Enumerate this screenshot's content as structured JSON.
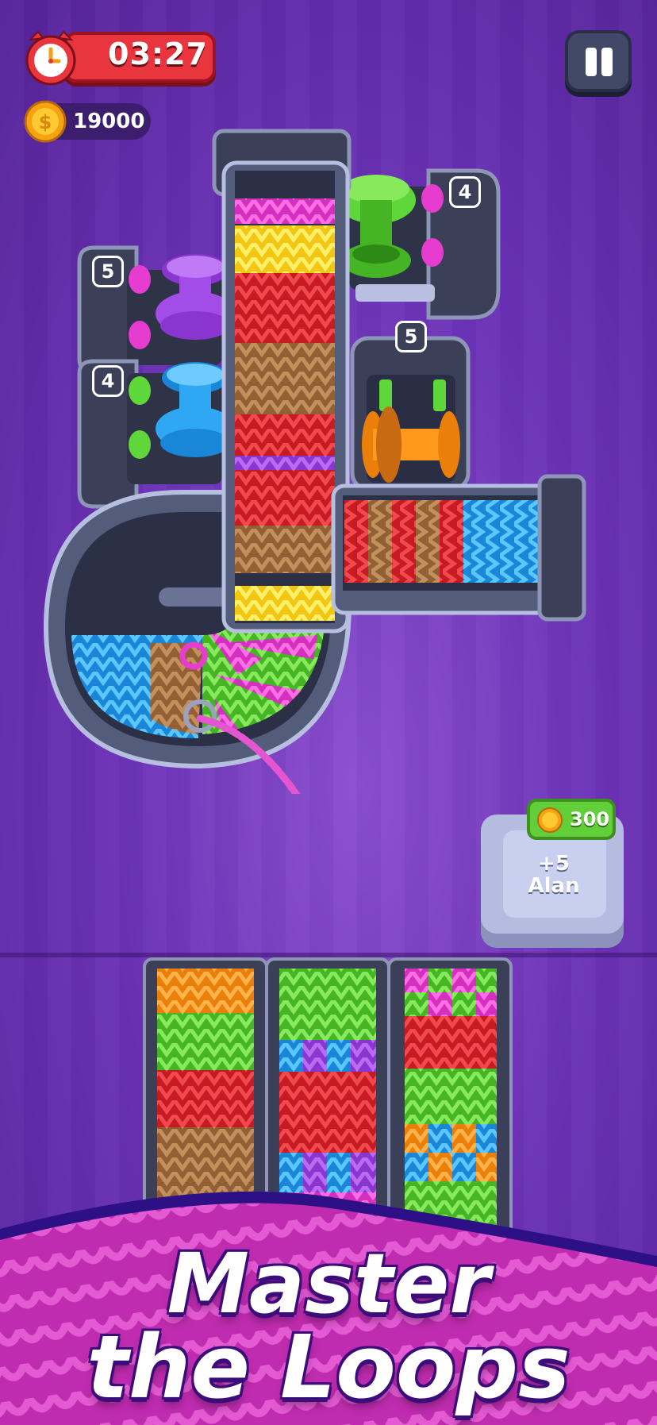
{
  "hud": {
    "timer": "03:27",
    "coins": "19000",
    "timer_icon": "alarm-clock-icon",
    "coin_icon": "coin-icon",
    "pause_icon": "pause-icon"
  },
  "spool_slots": [
    {
      "count": "5"
    },
    {
      "count": "4"
    },
    {
      "count": "4"
    },
    {
      "count": "5"
    }
  ],
  "promo": {
    "price": "300",
    "reward_line1": "+5",
    "reward_line2": "Alan"
  },
  "tagline": {
    "line1": "Master",
    "line2": "the Loops"
  },
  "colors": {
    "pink": "#e63ccf",
    "yellow": "#ffe132",
    "red": "#e8262e",
    "tan": "#b07a4a",
    "purple": "#a24de8",
    "green": "#5fd63a",
    "blue": "#2fa7f2",
    "orange": "#ff9a1f",
    "frame": "#4a5170"
  }
}
